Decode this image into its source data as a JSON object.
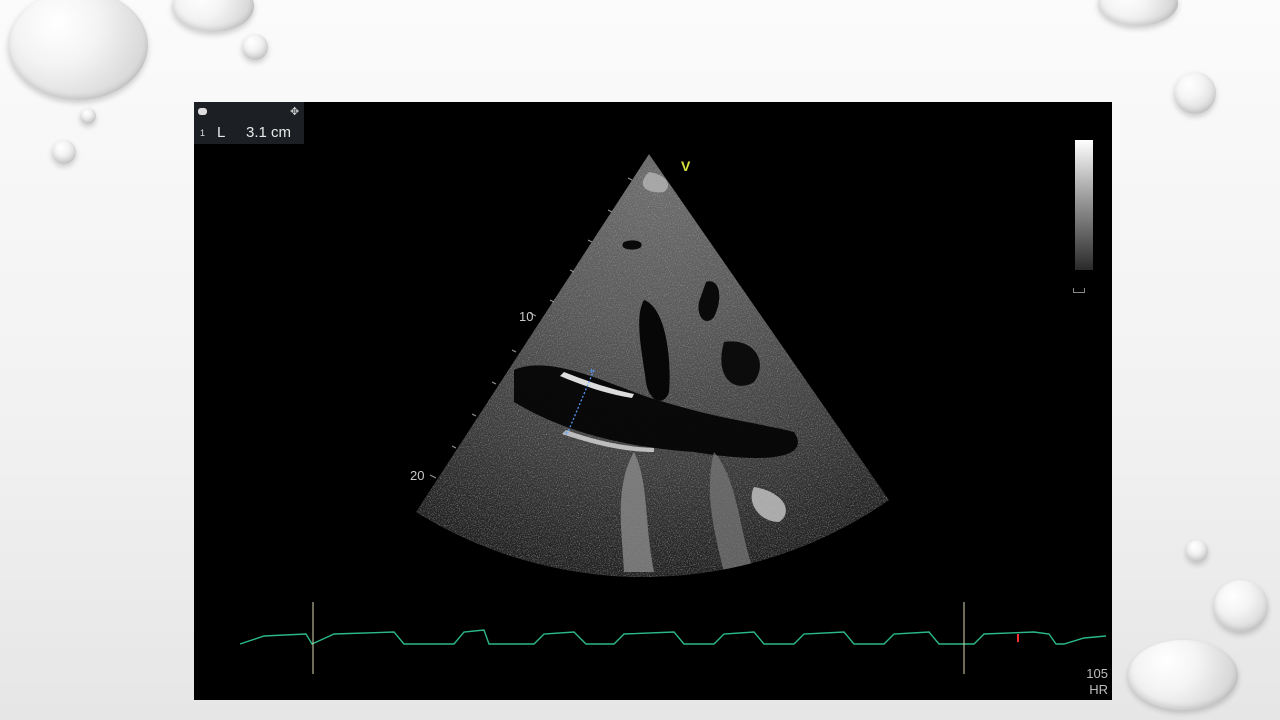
{
  "measurement": {
    "index": "1",
    "label": "L",
    "value": "3.1 cm"
  },
  "depth_markers": [
    "10",
    "20"
  ],
  "orientation_marker": "V",
  "heart_rate": {
    "value": "105",
    "label": "HR"
  },
  "icons": {
    "camera": "camera-icon",
    "move": "move-icon"
  },
  "colors": {
    "ecg_trace": "#2bb88a",
    "orientation_marker": "#d8e43a",
    "caliper": "#5a9cff",
    "background": "#000000"
  }
}
